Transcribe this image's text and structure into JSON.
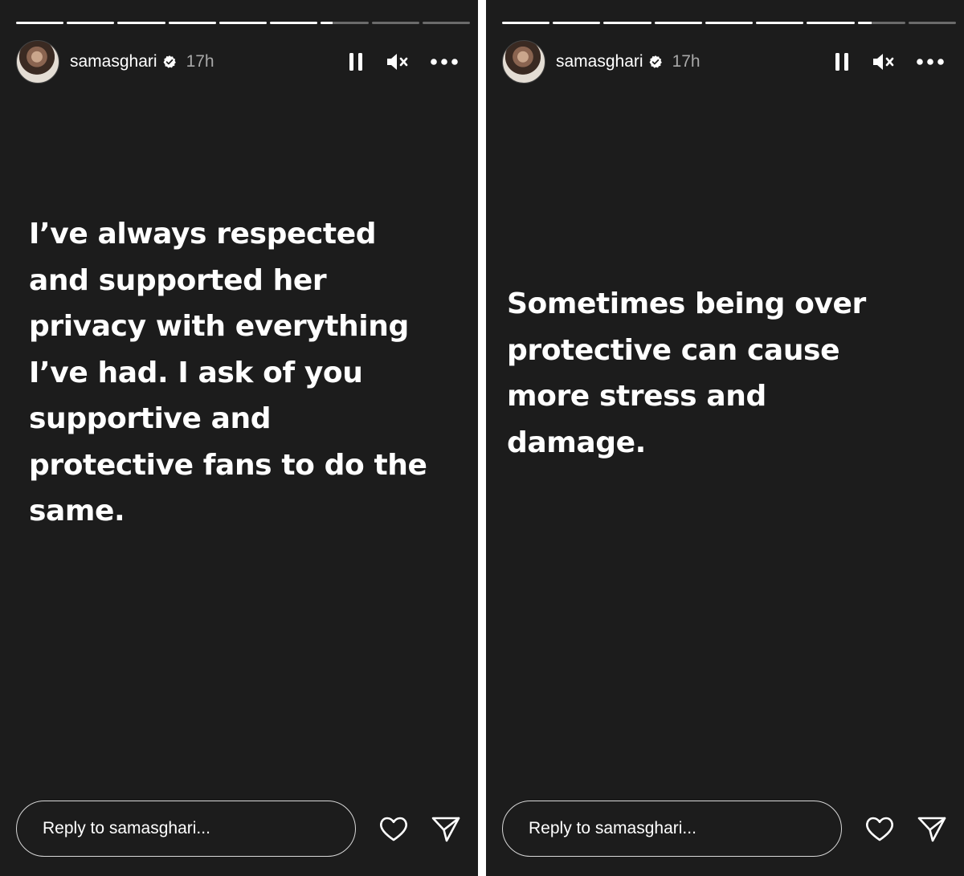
{
  "stories": [
    {
      "progress": {
        "segment_fill": [
          1,
          1,
          1,
          1,
          1,
          1,
          0.25,
          0,
          0
        ]
      },
      "header": {
        "username": "samasghari",
        "verified": true,
        "time": "17h"
      },
      "controls": {
        "pause_icon": "pause-icon",
        "mute_icon": "muted-speaker-icon",
        "more_icon": "more-dots-icon"
      },
      "text": "I’ve always respected\nand supported her\nprivacy with everything\nI’ve had. I ask of you\nsupportive and\nprotective fans to do the\nsame.",
      "reply": {
        "placeholder": "Reply to samasghari..."
      },
      "actions": {
        "like_icon": "heart-icon",
        "send_icon": "paper-plane-icon"
      }
    },
    {
      "progress": {
        "segment_fill": [
          1,
          1,
          1,
          1,
          1,
          1,
          1,
          0.3,
          0
        ]
      },
      "header": {
        "username": "samasghari",
        "verified": true,
        "time": "17h"
      },
      "controls": {
        "pause_icon": "pause-icon",
        "mute_icon": "muted-speaker-icon",
        "more_icon": "more-dots-icon"
      },
      "text": "Sometimes being over\nprotective can cause\nmore stress and\ndamage.",
      "reply": {
        "placeholder": "Reply to samasghari..."
      },
      "actions": {
        "like_icon": "heart-icon",
        "send_icon": "paper-plane-icon"
      }
    }
  ],
  "colors": {
    "background": "#1c1c1c",
    "text": "#ffffff",
    "muted_text": "#a8a8a8"
  }
}
